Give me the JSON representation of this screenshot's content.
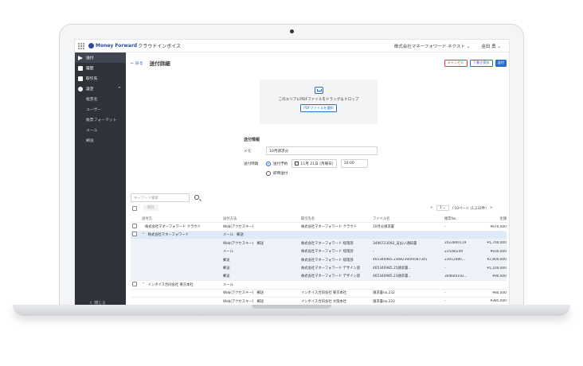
{
  "topbar": {
    "logo_main": "Money Forward",
    "logo_sub": "クラウドインボイス",
    "company": "株式会社マネーフォワード ネクスト ⌄",
    "user": "金田 勇 ⌄"
  },
  "sidebar": {
    "items": [
      {
        "label": "送付",
        "icon": "send-icon"
      },
      {
        "label": "履歴",
        "icon": "document-icon"
      },
      {
        "label": "取引先",
        "icon": "contacts-icon"
      },
      {
        "label": "設定",
        "icon": "gear-icon"
      }
    ],
    "settings_caret": "^",
    "sub_items": [
      "帳票名",
      "ユーザー",
      "帳票フォーマット",
      "メール",
      "郵送"
    ],
    "collapse": "く 閉じる"
  },
  "header": {
    "back": "← 戻る",
    "title": "送付詳細",
    "cancel": "キャンセル",
    "draft": "下書き保存",
    "send": "送付"
  },
  "upload": {
    "text": "このエリアにPDFファイルをドラッグ＆ドロップ",
    "button": "PDFファイルを選択"
  },
  "send_info": {
    "title": "送付情報",
    "memo_label": "メモ",
    "memo_value": "10月請求分",
    "timing_label": "送付時期",
    "scheduled_label": "送付予約",
    "date_value": "11月 21日 (月曜日)",
    "time_value": "10:00",
    "immediate_label": "即時送付"
  },
  "table": {
    "search_placeholder": "キーワード検索",
    "delete": "削除",
    "pager_page": "1",
    "pager_caret": "⌄",
    "pager_text": "/ 10ページ (1,232件)",
    "pager_next": ">",
    "columns": [
      "送付元",
      "送付方法",
      "取引先名",
      "ファイル名",
      "帳票No.",
      "金額"
    ],
    "rows": [
      {
        "cls": "",
        "cb": true,
        "chev": "",
        "from": "株式会社マネーフォワード クラウド",
        "method": "Web(アクセスキー)",
        "client": "株式会社マネーフォワード クラウド",
        "file": "10月分請求書",
        "no": "-",
        "amount": "¥670,000"
      },
      {
        "cls": "sel",
        "cb": true,
        "chev": "^",
        "from": "株式会社マネーフォワード",
        "method": "メール　郵送",
        "client": "",
        "file": "",
        "no": "",
        "amount": ""
      },
      {
        "cls": "child",
        "cb": false,
        "chev": "",
        "from": "",
        "method": "Web(アクセスキー)　郵送",
        "client": "株式会社マネーフォワード 経理部",
        "file": "3496723092_支払い通知書",
        "no": "2022840119",
        "amount": "¥1,700,000"
      },
      {
        "cls": "child",
        "cb": false,
        "chev": "",
        "from": "",
        "method": "メール",
        "client": "株式会社マネーフォワード 経理部",
        "file": "-",
        "no": "23508l249",
        "amount": "¥930,000"
      },
      {
        "cls": "child",
        "cb": false,
        "chev": "",
        "from": "",
        "method": "郵送",
        "client": "株式会社マネーフォワード 経理部",
        "file": "465340985.2308239/04587345",
        "no": "23012480...",
        "amount": "¥2,800,000"
      },
      {
        "cls": "child",
        "cb": false,
        "chev": "",
        "from": "",
        "method": "郵送",
        "client": "株式会社マネーフォワード デザイン部",
        "file": "465340985.25請求書...",
        "no": "-",
        "amount": "¥1,100,000"
      },
      {
        "cls": "child",
        "cb": false,
        "chev": "",
        "from": "",
        "method": "郵送",
        "client": "株式会社マネーフォワード デザイン部",
        "file": "465340985.23請求書...",
        "no": "304640192...",
        "amount": "¥90,000"
      },
      {
        "cls": "",
        "cb": true,
        "chev": "^",
        "from": "インボイス合同会社 東京本社",
        "method": "メール",
        "client": "",
        "file": "",
        "no": "",
        "amount": ""
      },
      {
        "cls": "",
        "cb": false,
        "chev": "",
        "from": "",
        "method": "Web(アクセスキー)　郵送",
        "client": "インボイス合同会社 東京本社",
        "file": "請求書no.232",
        "no": "-",
        "amount": "¥80,000"
      },
      {
        "cls": "",
        "cb": false,
        "chev": "",
        "from": "",
        "method": "Web(アクセスキー)　郵送",
        "client": "インボイス合同会社 大阪本社",
        "file": "請求書no.233",
        "no": "-",
        "amount": "¥385,000"
      }
    ]
  }
}
